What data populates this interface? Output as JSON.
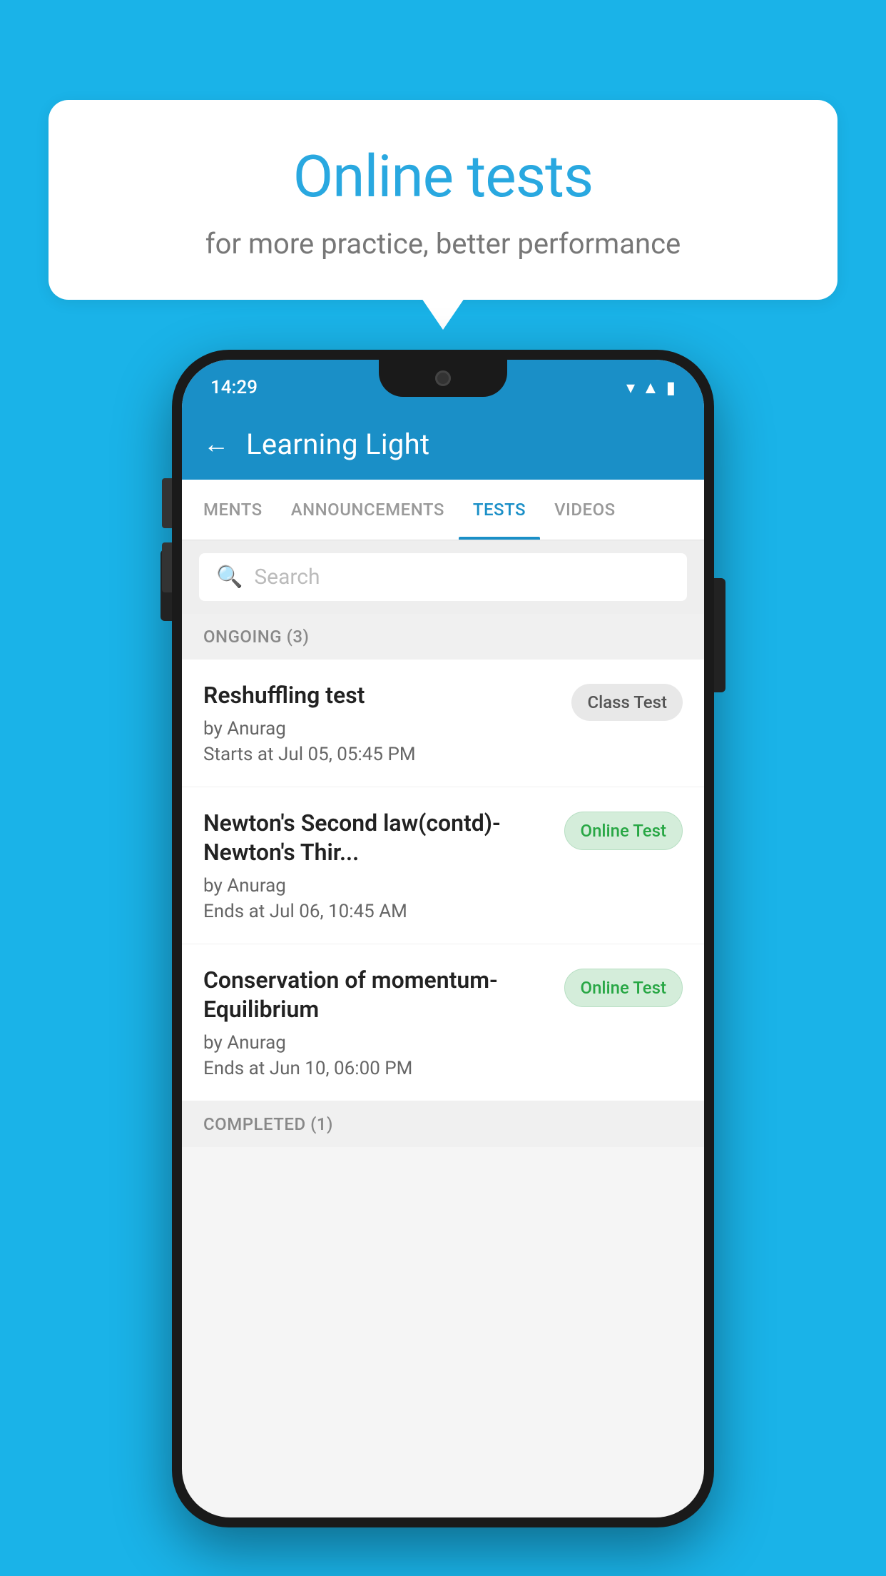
{
  "background_color": "#1ab3e8",
  "bubble": {
    "title": "Online tests",
    "subtitle": "for more practice, better performance"
  },
  "phone": {
    "status_bar": {
      "time": "14:29",
      "icons": [
        "wifi",
        "signal",
        "battery"
      ]
    },
    "header": {
      "back_label": "←",
      "title": "Learning Light"
    },
    "tabs": [
      {
        "label": "MENTS",
        "active": false
      },
      {
        "label": "ANNOUNCEMENTS",
        "active": false
      },
      {
        "label": "TESTS",
        "active": true
      },
      {
        "label": "VIDEOS",
        "active": false
      }
    ],
    "search": {
      "placeholder": "Search"
    },
    "ongoing_section": {
      "label": "ONGOING (3)"
    },
    "tests": [
      {
        "name": "Reshuffling test",
        "author": "by Anurag",
        "date_label": "Starts at",
        "date": "Jul 05, 05:45 PM",
        "badge": "Class Test",
        "badge_type": "class"
      },
      {
        "name": "Newton's Second law(contd)-Newton's Thir...",
        "author": "by Anurag",
        "date_label": "Ends at",
        "date": "Jul 06, 10:45 AM",
        "badge": "Online Test",
        "badge_type": "online"
      },
      {
        "name": "Conservation of momentum-Equilibrium",
        "author": "by Anurag",
        "date_label": "Ends at",
        "date": "Jun 10, 06:00 PM",
        "badge": "Online Test",
        "badge_type": "online"
      }
    ],
    "completed_section": {
      "label": "COMPLETED (1)"
    }
  }
}
